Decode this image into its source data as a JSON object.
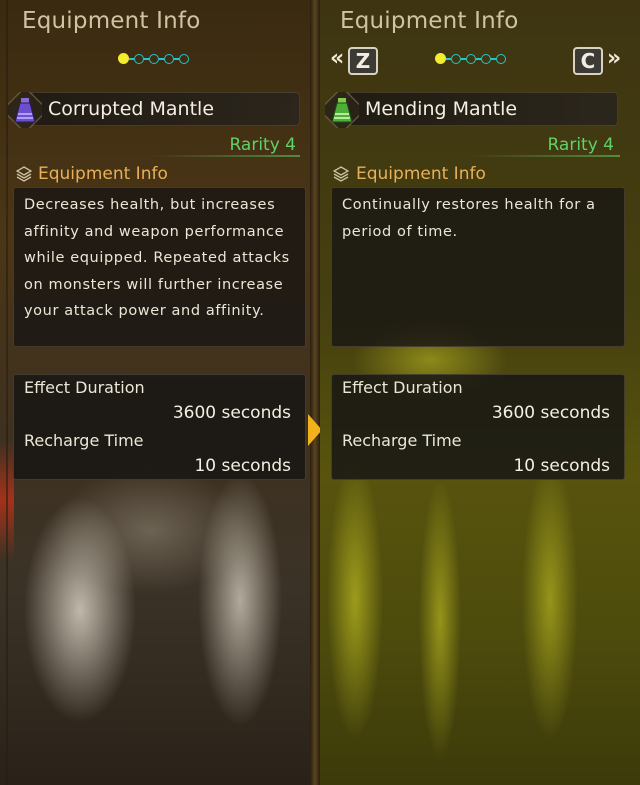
{
  "left": {
    "title": "Equipment Info",
    "page_indicator": {
      "current": 1,
      "total": 5
    },
    "item_name": "Corrupted Mantle",
    "item_icon": "purple-mantle-icon",
    "rarity": "Rarity 4",
    "section_label": "Equipment Info",
    "description": "Decreases health, but increases affinity and weapon performance while equipped. Repeated attacks on monsters will further increase your attack power and affinity.",
    "stats": [
      {
        "label": "Effect Duration",
        "value": "3600 seconds"
      },
      {
        "label": "Recharge Time",
        "value": "10 seconds"
      }
    ]
  },
  "right": {
    "title": "Equipment Info",
    "page_indicator": {
      "current": 1,
      "total": 5
    },
    "prev_key": "Z",
    "next_key": "C",
    "item_name": "Mending Mantle",
    "item_icon": "green-mantle-icon",
    "rarity": "Rarity 4",
    "section_label": "Equipment Info",
    "description": "Continually restores health for a period of time.",
    "stats": [
      {
        "label": "Effect Duration",
        "value": "3600 seconds"
      },
      {
        "label": "Recharge Time",
        "value": "10 seconds"
      }
    ]
  },
  "colors": {
    "rarity": "#5fd267",
    "section_label": "#e8b05a",
    "dot_active": "#f4ec2e",
    "dot_inactive": "#23c6c9",
    "arrow": "#f2b21c"
  }
}
